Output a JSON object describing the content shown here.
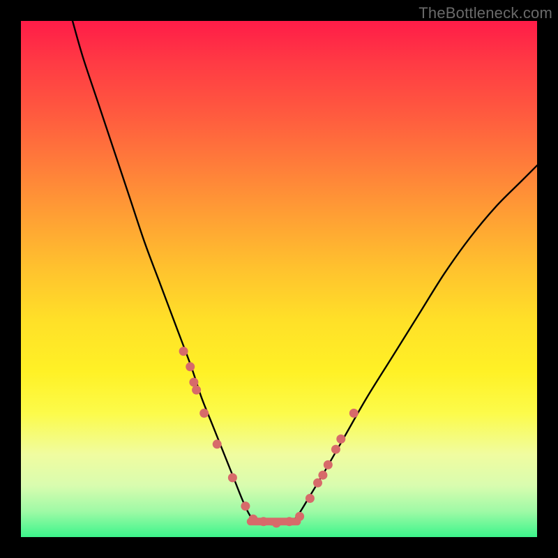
{
  "watermark": "TheBottleneck.com",
  "colors": {
    "curve": "#000000",
    "marker": "#d76a6a",
    "background_top": "#ff1c48",
    "background_bottom": "#3cf58b",
    "frame": "#000000"
  },
  "chart_data": {
    "type": "line",
    "title": "",
    "xlabel": "",
    "ylabel": "",
    "xlim": [
      0,
      100
    ],
    "ylim": [
      0,
      100
    ],
    "grid": false,
    "legend": false,
    "annotations": [],
    "series": [
      {
        "name": "left_branch",
        "x": [
          10,
          12,
          15,
          18,
          21,
          24,
          27,
          30,
          33,
          35,
          37,
          39,
          41,
          43,
          44.5
        ],
        "y": [
          100,
          93,
          84,
          75,
          66,
          57,
          49,
          41,
          33,
          27,
          22,
          17,
          12,
          7,
          4
        ]
      },
      {
        "name": "flat_bottom",
        "x": [
          44.5,
          46,
          48,
          50,
          52,
          53.5
        ],
        "y": [
          4,
          3,
          2.5,
          2.5,
          3,
          4
        ]
      },
      {
        "name": "right_branch",
        "x": [
          53.5,
          56,
          59,
          63,
          67,
          72,
          77,
          82,
          87,
          92,
          97,
          100
        ],
        "y": [
          4,
          8,
          13,
          20,
          27,
          35,
          43,
          51,
          58,
          64,
          69,
          72
        ]
      }
    ],
    "markers": {
      "name": "dots",
      "x": [
        31.5,
        32.8,
        33.5,
        34.0,
        35.5,
        38.0,
        41.0,
        43.5,
        45.0,
        47.0,
        49.5,
        52.0,
        54.0,
        56.0,
        57.5,
        58.5,
        59.5,
        61.0,
        62.0,
        64.5
      ],
      "y": [
        36.0,
        33.0,
        30.0,
        28.5,
        24.0,
        18.0,
        11.5,
        6.0,
        3.5,
        3.0,
        2.7,
        3.0,
        4.0,
        7.5,
        10.5,
        12.0,
        14.0,
        17.0,
        19.0,
        24.0
      ]
    },
    "flat_segment": {
      "x": [
        44.5,
        53.5
      ],
      "y": 3
    }
  }
}
